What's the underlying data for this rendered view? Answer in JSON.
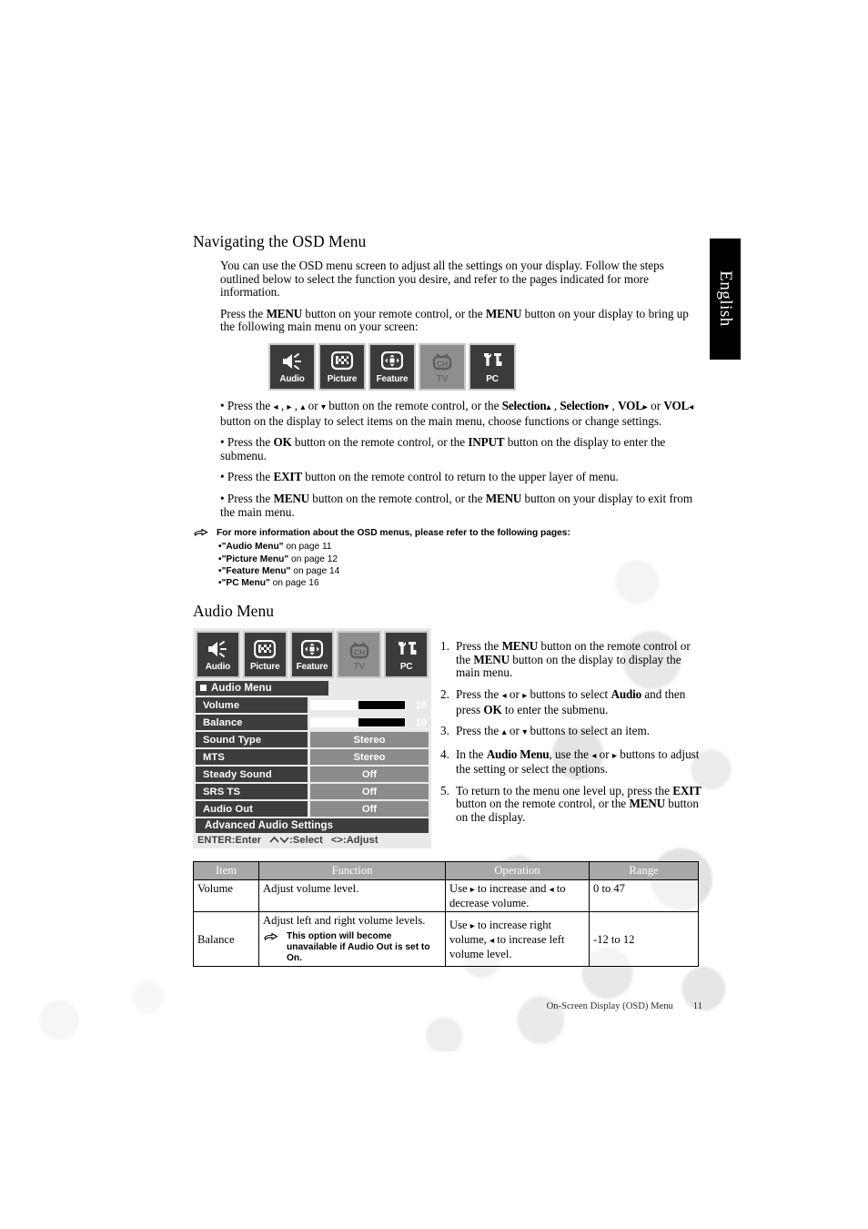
{
  "page": {
    "language_tab": "English",
    "footer_text": "On-Screen Display (OSD) Menu",
    "footer_page_number": "11"
  },
  "navigating": {
    "title": "Navigating the OSD Menu",
    "para1": "You can use the OSD menu screen to adjust all the settings on your display. Follow the steps outlined below to select the function you desire, and refer to the pages indicated for more information.",
    "para2_a": "Press the ",
    "para2_b": "MENU",
    "para2_c": " button on your remote control, or the ",
    "para2_d": "MENU",
    "para2_e": " button on your display to bring up the following main menu on your screen:",
    "bullets": [
      {
        "t1": "Press the ",
        "a1": "◂",
        "t2": " , ",
        "a2": "▸",
        "t3": " , ",
        "a3": "▴",
        "t4": " or ",
        "a4": "▾",
        "t5": " button on the remote control, or the ",
        "b1": "Selection",
        "a5": "▴",
        "t6": " , ",
        "b2": "Selection",
        "a6": "▾",
        "t7": " , ",
        "b3": "VOL",
        "a7": "▸",
        "t8": " or ",
        "b4": "VOL",
        "a8": "◂",
        "t9": " button on the display to select items on the main menu, choose functions or change settings."
      },
      {
        "t1": "Press the ",
        "b1": "OK",
        "t2": " button on the remote control, or the ",
        "b2": "INPUT",
        "t3": " button on the display to enter the submenu."
      },
      {
        "t1": "Press the ",
        "b1": "EXIT",
        "t2": " button on the remote control to return to the upper layer of menu."
      },
      {
        "t1": "Press the ",
        "b1": "MENU",
        "t2": "  button on the remote control, or the ",
        "b2": "MENU",
        "t3": " button on your display to exit from the main menu."
      }
    ]
  },
  "tip_note": {
    "heading": "For more information about the OSD menus, please refer to the following pages:",
    "items": [
      {
        "quoted": "•\"Audio Menu\"",
        "rest": " on page  11"
      },
      {
        "quoted": "•\"Picture Menu\"",
        "rest": " on page  12"
      },
      {
        "quoted": "•\"Feature Menu\"",
        "rest": " on page  14"
      },
      {
        "quoted": "•\"PC Menu\"",
        "rest": " on page  16"
      }
    ]
  },
  "osd_main_menu": {
    "tiles": [
      {
        "label": "Audio",
        "icon": "speaker-icon",
        "state": "active"
      },
      {
        "label": "Picture",
        "icon": "checker-icon",
        "state": "active"
      },
      {
        "label": "Feature",
        "icon": "arrows-icon",
        "state": "active"
      },
      {
        "label": "TV",
        "icon": "tv-ch-icon",
        "state": "disabled"
      },
      {
        "label": "PC",
        "icon": "tools-icon",
        "state": "active"
      }
    ]
  },
  "audio_menu_section": {
    "title": "Audio Menu",
    "osd": {
      "menu_title": "Audio Menu",
      "rows": [
        {
          "name": "Volume",
          "type": "bar",
          "value": "10",
          "fill_percent": 50
        },
        {
          "name": "Balance",
          "type": "bar",
          "value": "10",
          "fill_percent": 50
        },
        {
          "name": "Sound Type",
          "type": "value",
          "value": "Stereo"
        },
        {
          "name": "MTS",
          "type": "value",
          "value": "Stereo"
        },
        {
          "name": "Steady Sound",
          "type": "value",
          "value": "Off"
        },
        {
          "name": "SRS TS",
          "type": "value",
          "value": "Off"
        },
        {
          "name": "Audio Out",
          "type": "value",
          "value": "Off"
        }
      ],
      "submenu_item": "Advanced Audio Settings",
      "hint_enter": "ENTER:Enter",
      "hint_select": ":Select",
      "hint_adjust": "<>:Adjust"
    },
    "steps": [
      {
        "num": "1.",
        "t1": "Press the ",
        "b1": "MENU",
        "t2": " button on the remote control or the ",
        "b2": "MENU",
        "t3": " button on the display to display the main menu."
      },
      {
        "num": "2.",
        "t1": "Press the ",
        "a1": "◂",
        "t2": " or ",
        "a2": "▸",
        "t3": " buttons to select ",
        "b1": "Audio",
        "t4": " and then press ",
        "b2": "OK",
        "t5": " to enter the submenu."
      },
      {
        "num": "3.",
        "t1": "Press the ",
        "a1": "▴",
        "t2": " or ",
        "a2": "▾",
        "t3": " buttons to select an item."
      },
      {
        "num": "4.",
        "t1": "In the ",
        "b1": "Audio Menu",
        "t2": ", use the ",
        "a1": "◂",
        "t3": " or ",
        "a2": "▸",
        "t4": " buttons to adjust the setting or select the options."
      },
      {
        "num": "5.",
        "t1": "To return to the menu one level up, press the ",
        "b1": "EXIT",
        "t2": " button on the remote control, or the ",
        "b2": "MENU",
        "t3": " button on the display."
      }
    ]
  },
  "spec_table": {
    "headers": [
      "Item",
      "Function",
      "Operation",
      "Range"
    ],
    "rows": [
      {
        "item": "Volume",
        "function": "Adjust volume level.",
        "operation_t1": "Use ",
        "operation_a1": "▸",
        "operation_t2": " to increase and ",
        "operation_a2": "◂",
        "operation_t3": " to decrease volume.",
        "range": "0 to 47"
      },
      {
        "item": "Balance",
        "function": "Adjust left and right volume levels.",
        "function_tip": "This option will become unavailable if Audio Out is set to On.",
        "operation_t1": "Use ",
        "operation_a1": "▸",
        "operation_t2": " to increase right volume, ",
        "operation_a2": "◂",
        "operation_t3": " to increase left volume level.",
        "range": "-12 to 12"
      }
    ]
  }
}
